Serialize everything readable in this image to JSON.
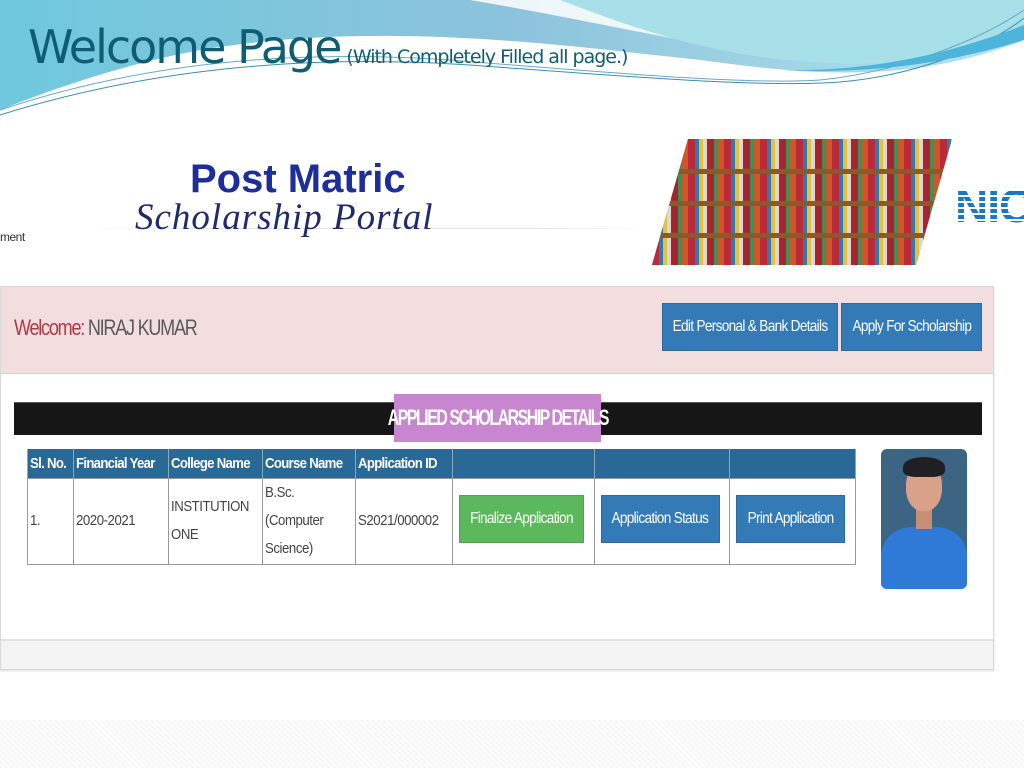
{
  "slide": {
    "title": "Welcome Page",
    "subtitle": "(With Completely Filled all page.)"
  },
  "banner": {
    "gov_text_fragment": "ment",
    "portal_title_line1": "Post Matric",
    "portal_title_line2": "Scholarship Portal",
    "nic_logo_text": "NIC"
  },
  "welcome": {
    "label": "Welcome:",
    "user_name": "NIRAJ KUMAR",
    "buttons": {
      "edit_details": "Edit Personal & Bank Details",
      "apply": "Apply For Scholarship"
    }
  },
  "section": {
    "heading": "APPLIED SCHOLARSHIP DETAILS"
  },
  "table": {
    "columns": [
      "Sl. No.",
      "Financial Year",
      "College Name",
      "Course Name",
      "Application ID",
      "",
      "",
      ""
    ],
    "rows": [
      {
        "sl_no": "1.",
        "financial_year": "2020-2021",
        "college_name": "INSTITUTION ONE",
        "course_name": "B.Sc. (Computer Science)",
        "application_id": "S2021/000002",
        "actions": {
          "finalize": "Finalize Application",
          "status": "Application Status",
          "print": "Print Application"
        }
      }
    ]
  },
  "colors": {
    "title_teal": "#0f5d73",
    "welcome_bg": "#f2dede",
    "primary_button": "#337ab7",
    "success_button": "#5cb85c",
    "section_label_bg": "#c986d0",
    "table_header_bg": "#2a6896"
  }
}
